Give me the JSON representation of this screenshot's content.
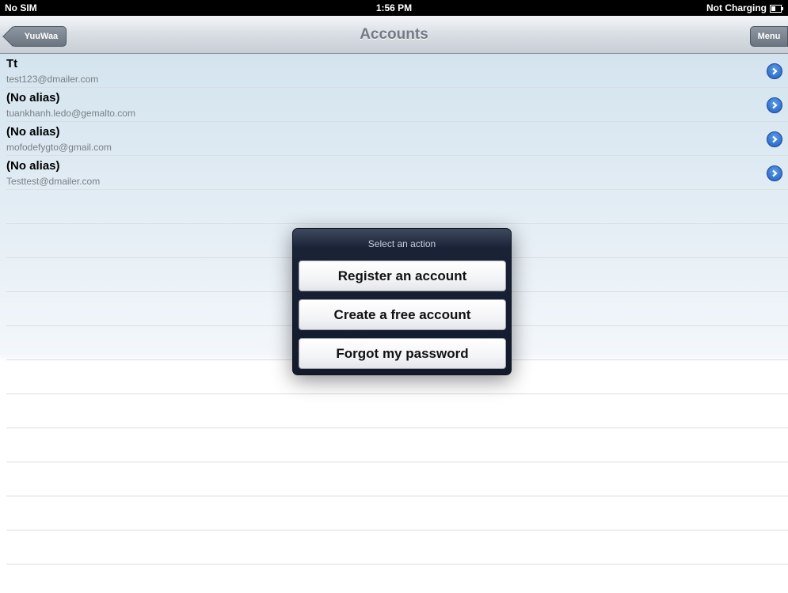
{
  "status_bar": {
    "carrier": "No SIM",
    "time": "1:56 PM",
    "battery_text": "Not Charging",
    "battery_icon": "battery-icon"
  },
  "nav_bar": {
    "title": "Accounts",
    "back_label": "YuuWaa",
    "menu_label": "Menu"
  },
  "accounts": [
    {
      "alias": "Tt",
      "email": "test123@dmailer.com"
    },
    {
      "alias": "(No alias)",
      "email": "tuankhanh.ledo@gemalto.com"
    },
    {
      "alias": "(No alias)",
      "email": "mofodefygto@gmail.com"
    },
    {
      "alias": "(No alias)",
      "email": "Testtest@dmailer.com"
    }
  ],
  "action_sheet": {
    "title": "Select an action",
    "actions": [
      "Register an account",
      "Create a free account",
      "Forgot my password"
    ]
  },
  "colors": {
    "accent_blue": "#1f5fc4",
    "popover_bg": "#1a2236"
  }
}
